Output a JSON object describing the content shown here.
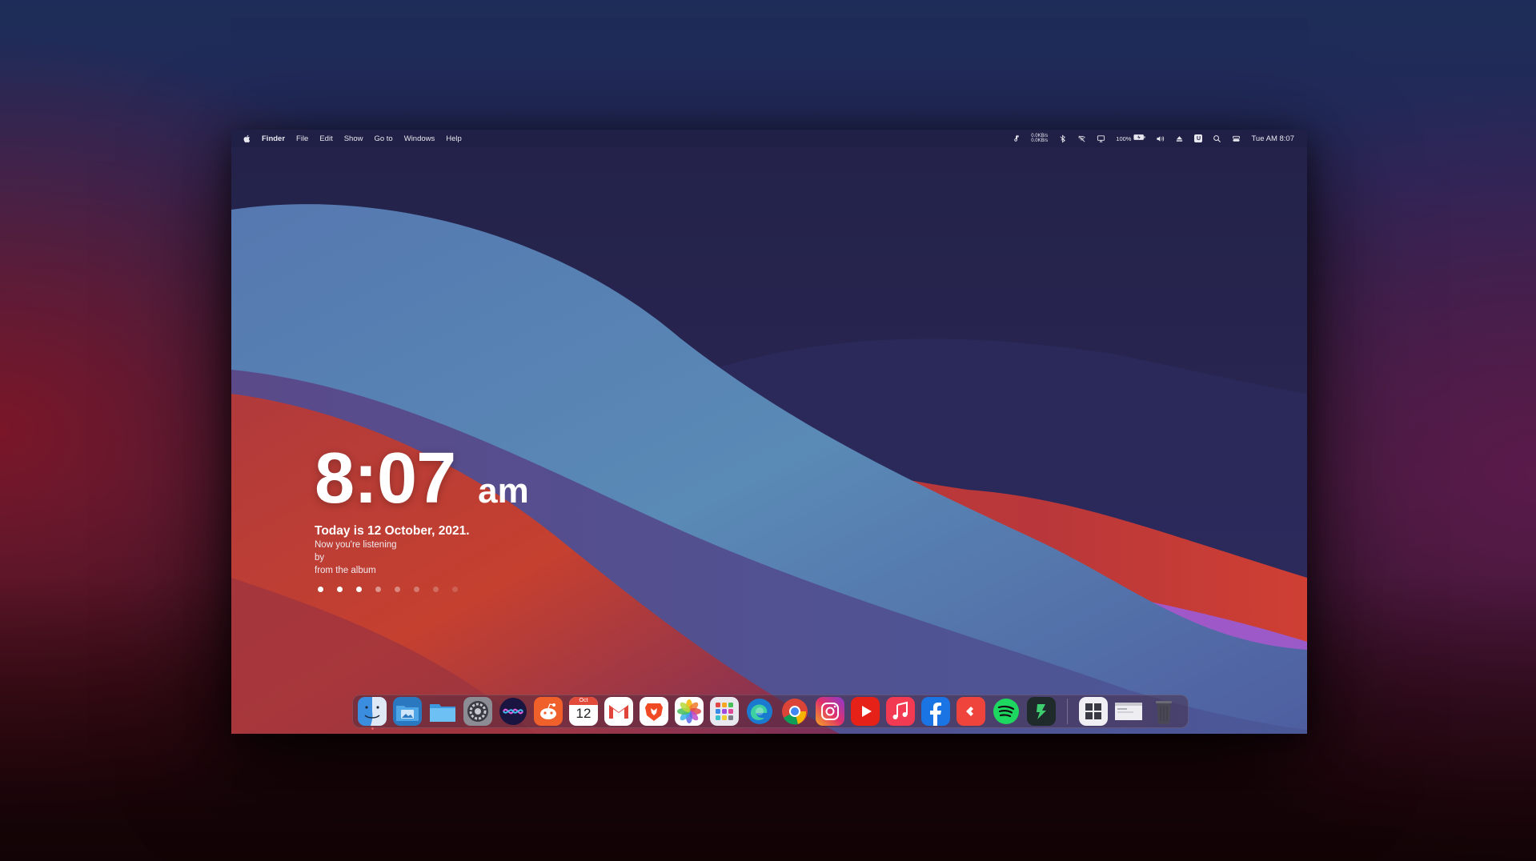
{
  "menubar": {
    "apple_icon": "apple-logo-icon",
    "items": [
      "Finder",
      "File",
      "Edit",
      "Show",
      "Go to",
      "Windows",
      "Help"
    ],
    "net_up": "0.0KB/s",
    "net_down": "0.0KB/s",
    "battery_percent": "100%",
    "clock": "Tue AM 8:07"
  },
  "widget": {
    "time": "8:07",
    "ampm": "am",
    "date": "Today is 12 October, 2021.",
    "now_playing": "Now you're listening",
    "by": "by",
    "album": "from the album",
    "page_dots_total": 8,
    "page_dots_active": 3
  },
  "dock": {
    "calendar_month": "Oct",
    "calendar_day": "12",
    "apps": [
      "finder",
      "image-capture",
      "folder",
      "system-preferences",
      "siri",
      "reddit",
      "calendar",
      "gmail",
      "brave",
      "photos",
      "launchpad",
      "edge",
      "chrome",
      "instagram",
      "youtube",
      "music",
      "facebook",
      "anydesk",
      "spotify",
      "deepl",
      "windows",
      "window-preview",
      "trash"
    ]
  },
  "colors": {
    "accent_red": "#d2453a",
    "accent_blue": "#5a86b4",
    "accent_purple": "#a452c8"
  }
}
